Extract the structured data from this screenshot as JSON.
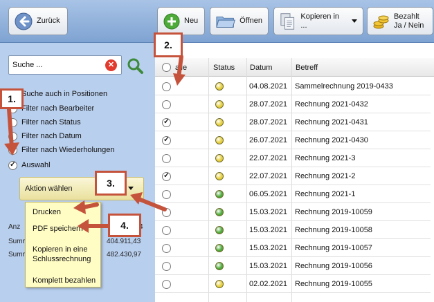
{
  "toolbar": {
    "back_label": "Zurück",
    "new_label": "Neu",
    "open_label": "Öffnen",
    "copy_label": "Kopieren in ...",
    "paid_label": "Bezahlt\nJa / Nein"
  },
  "left_panel": {
    "search_value": "Suche ...",
    "options": [
      {
        "label": "Suche auch in Positionen",
        "checked": false
      },
      {
        "label": "Filter nach Bearbeiter",
        "checked": false
      },
      {
        "label": "Filter nach Status",
        "checked": false
      },
      {
        "label": "Filter nach Datum",
        "checked": false
      },
      {
        "label": "Filter nach Wiederholungen",
        "checked": false
      },
      {
        "label": "Auswahl",
        "checked": true
      }
    ],
    "action_select": "Aktion wählen",
    "stats": {
      "anz_prefix": "Anz",
      "anz_value_tail": "4",
      "summ1_prefix": "Summ",
      "summ1_value": "404.911,43",
      "summ2_prefix": "Summ",
      "summ2_value": "482.430,97"
    },
    "menu_items": [
      "Drucken",
      "PDF speichern",
      "Kopieren in eine Schlussrechnung",
      "Komplett bezahlen"
    ]
  },
  "table": {
    "headers": {
      "select": "alle",
      "status": "Status",
      "date": "Datum",
      "subject": "Betreff"
    },
    "rows": [
      {
        "checked": false,
        "status": "yellow",
        "date": "04.08.2021",
        "subject": "Sammelrechnung 2019-0433"
      },
      {
        "checked": false,
        "status": "yellow",
        "date": "28.07.2021",
        "subject": "Rechnung 2021-0432"
      },
      {
        "checked": true,
        "status": "yellow",
        "date": "28.07.2021",
        "subject": "Rechnung 2021-0431"
      },
      {
        "checked": true,
        "status": "yellow",
        "date": "26.07.2021",
        "subject": "Rechnung 2021-0430"
      },
      {
        "checked": false,
        "status": "yellow",
        "date": "22.07.2021",
        "subject": "Rechnung 2021-3"
      },
      {
        "checked": true,
        "status": "yellow",
        "date": "22.07.2021",
        "subject": "Rechnung 2021-2"
      },
      {
        "checked": false,
        "status": "green",
        "date": "06.05.2021",
        "subject": "Rechnung 2021-1"
      },
      {
        "checked": false,
        "status": "green",
        "date": "15.03.2021",
        "subject": "Rechnung 2019-10059"
      },
      {
        "checked": false,
        "status": "green",
        "date": "15.03.2021",
        "subject": "Rechnung 2019-10058"
      },
      {
        "checked": false,
        "status": "green",
        "date": "15.03.2021",
        "subject": "Rechnung 2019-10057"
      },
      {
        "checked": false,
        "status": "green",
        "date": "15.03.2021",
        "subject": "Rechnung 2019-10056"
      },
      {
        "checked": false,
        "status": "yellow",
        "date": "02.02.2021",
        "subject": "Rechnung 2019-10055"
      }
    ]
  },
  "annotations": [
    "1.",
    "2.",
    "3.",
    "4."
  ],
  "colors": {
    "status_yellow": "#e6cf3a",
    "status_green": "#4eab3a",
    "annotation": "#c5533c"
  }
}
